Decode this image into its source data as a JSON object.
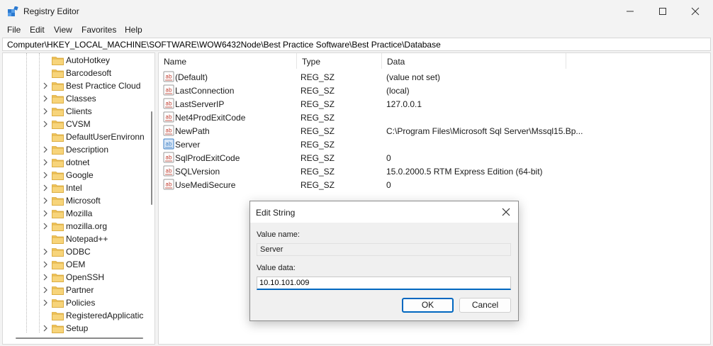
{
  "window": {
    "title": "Registry Editor"
  },
  "menu": [
    "File",
    "Edit",
    "View",
    "Favorites",
    "Help"
  ],
  "address": "Computer\\HKEY_LOCAL_MACHINE\\SOFTWARE\\WOW6432Node\\Best Practice Software\\Best Practice\\Database",
  "tree": {
    "items": [
      {
        "label": "AutoHotkey",
        "expandable": false
      },
      {
        "label": "Barcodesoft",
        "expandable": false
      },
      {
        "label": "Best Practice Cloud",
        "expandable": true
      },
      {
        "label": "Classes",
        "expandable": true
      },
      {
        "label": "Clients",
        "expandable": true
      },
      {
        "label": "CVSM",
        "expandable": true
      },
      {
        "label": "DefaultUserEnvironn",
        "expandable": false
      },
      {
        "label": "Description",
        "expandable": true
      },
      {
        "label": "dotnet",
        "expandable": true
      },
      {
        "label": "Google",
        "expandable": true
      },
      {
        "label": "Intel",
        "expandable": true
      },
      {
        "label": "Microsoft",
        "expandable": true
      },
      {
        "label": "Mozilla",
        "expandable": true
      },
      {
        "label": "mozilla.org",
        "expandable": true
      },
      {
        "label": "Notepad++",
        "expandable": false
      },
      {
        "label": "ODBC",
        "expandable": true
      },
      {
        "label": "OEM",
        "expandable": true
      },
      {
        "label": "OpenSSH",
        "expandable": true
      },
      {
        "label": "Partner",
        "expandable": true
      },
      {
        "label": "Policies",
        "expandable": true
      },
      {
        "label": "RegisteredApplicatic",
        "expandable": false
      },
      {
        "label": "Setup",
        "expandable": true
      }
    ]
  },
  "values_pane": {
    "columns": [
      "Name",
      "Type",
      "Data"
    ],
    "rows": [
      {
        "name": "(Default)",
        "type": "REG_SZ",
        "data": "(value not set)",
        "selected": false
      },
      {
        "name": "LastConnection",
        "type": "REG_SZ",
        "data": "(local)",
        "selected": false
      },
      {
        "name": "LastServerIP",
        "type": "REG_SZ",
        "data": "127.0.0.1",
        "selected": false
      },
      {
        "name": "Net4ProdExitCode",
        "type": "REG_SZ",
        "data": "",
        "selected": false
      },
      {
        "name": "NewPath",
        "type": "REG_SZ",
        "data": "C:\\Program Files\\Microsoft Sql Server\\Mssql15.Bp...",
        "selected": false
      },
      {
        "name": "Server",
        "type": "REG_SZ",
        "data": "",
        "selected": true
      },
      {
        "name": "SqlProdExitCode",
        "type": "REG_SZ",
        "data": "0",
        "selected": false
      },
      {
        "name": "SQLVersion",
        "type": "REG_SZ",
        "data": "15.0.2000.5 RTM Express Edition (64-bit)",
        "selected": false
      },
      {
        "name": "UseMediSecure",
        "type": "REG_SZ",
        "data": "0",
        "selected": false
      }
    ]
  },
  "dialog": {
    "title": "Edit String",
    "value_name_label": "Value name:",
    "value_name": "Server",
    "value_data_label": "Value data:",
    "value_data": "10.10.101.009",
    "ok_label": "OK",
    "cancel_label": "Cancel"
  },
  "icons": {
    "app": "registry-editor-icon",
    "folder": "folder-icon",
    "string_value": "string-value-icon"
  },
  "colors": {
    "accent": "#0067c0",
    "folder": "#f2c55c",
    "string_icon_red": "#c0392b",
    "selected_icon_blue": "#3c7fc4"
  }
}
